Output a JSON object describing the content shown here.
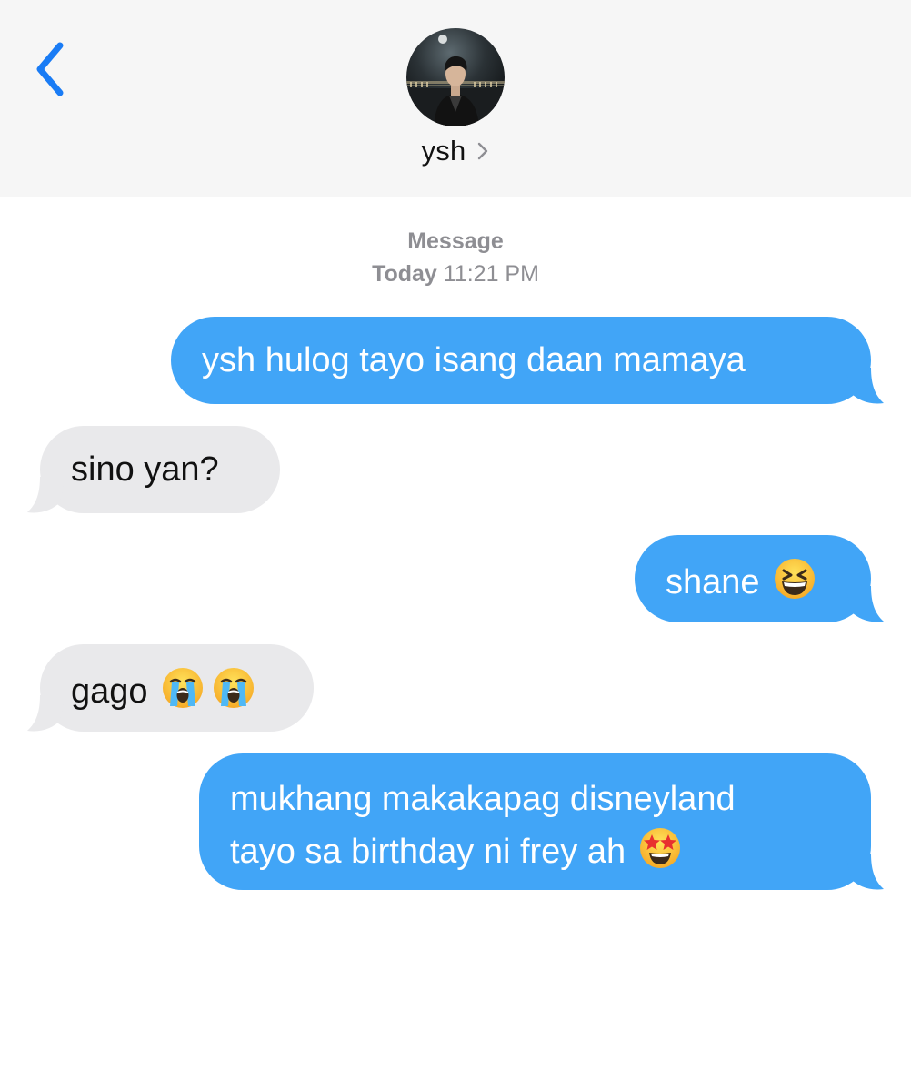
{
  "header": {
    "contact_name": "ysh",
    "back_icon": "chevron-left-icon",
    "name_chevron_icon": "chevron-right-icon"
  },
  "thread": {
    "service_label": "Message",
    "timestamp_day": "Today",
    "timestamp_time": "11:21 PM"
  },
  "messages": [
    {
      "direction": "sent",
      "text": "ysh hulog tayo isang daan mamaya"
    },
    {
      "direction": "received",
      "text": "sino yan?"
    },
    {
      "direction": "sent",
      "text": "shane",
      "emoji": [
        "grinning-squinting-face-emoji"
      ]
    },
    {
      "direction": "received",
      "text": "gago",
      "emoji": [
        "loudly-crying-face-emoji",
        "loudly-crying-face-emoji"
      ]
    },
    {
      "direction": "sent",
      "lines": [
        "mukhang makakapag disneyland",
        "tayo sa birthday ni frey ah"
      ],
      "emoji": [
        "star-struck-emoji"
      ]
    }
  ],
  "colors": {
    "sent_bubble": "#41a5f7",
    "received_bubble": "#e9e9eb",
    "ios_blue": "#1a7cf5",
    "meta_gray": "#8e8e93",
    "header_bg": "#f6f6f6"
  }
}
